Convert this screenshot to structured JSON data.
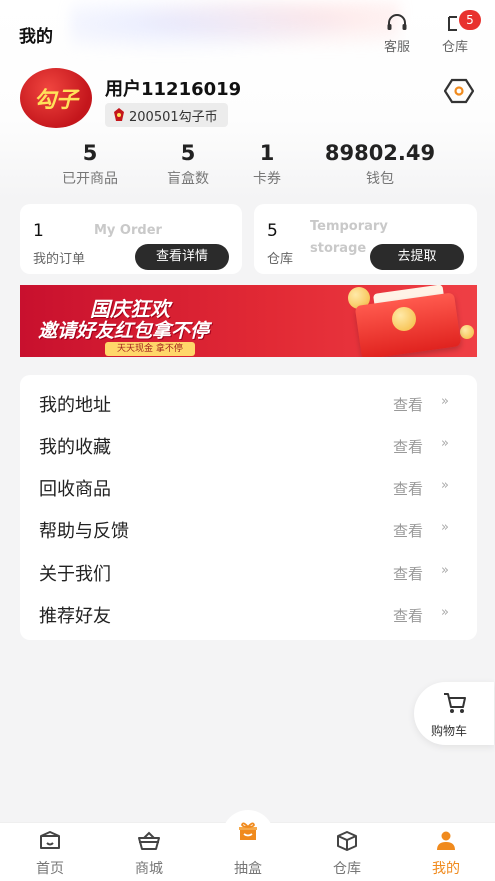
{
  "header": {
    "title": "我的",
    "service_label": "客服",
    "warehouse_label": "仓库",
    "warehouse_badge": "5"
  },
  "profile": {
    "avatar_text": "勾子",
    "username": "用户11216019",
    "coin_text": "200501勾子币"
  },
  "stats": [
    {
      "value": "5",
      "label": "已开商品"
    },
    {
      "value": "5",
      "label": "盲盒数"
    },
    {
      "value": "1",
      "label": "卡券"
    },
    {
      "value": "89802.49",
      "label": "钱包"
    }
  ],
  "order_card": {
    "count": "1",
    "english": "My Order",
    "name": "我的订单",
    "button": "查看详情"
  },
  "storage_card": {
    "count": "5",
    "english_1": "Temporary",
    "english_2": "storage",
    "name": "仓库",
    "button": "去提取"
  },
  "banner": {
    "line1": "国庆狂欢",
    "line2": "邀请好友红包拿不停",
    "sub": "天天现金 拿不停"
  },
  "menu": {
    "view_label": "查看",
    "items": [
      {
        "label": "我的地址"
      },
      {
        "label": "我的收藏"
      },
      {
        "label": "回收商品"
      },
      {
        "label": "帮助与反馈"
      },
      {
        "label": "关于我们"
      },
      {
        "label": "推荐好友"
      }
    ]
  },
  "cart": {
    "label": "购物车"
  },
  "tabs": [
    {
      "label": "首页",
      "icon": "home-box-icon"
    },
    {
      "label": "商城",
      "icon": "basket-icon"
    },
    {
      "label": "抽盒",
      "icon": "gift-box-icon"
    },
    {
      "label": "仓库",
      "icon": "cube-icon"
    },
    {
      "label": "我的",
      "icon": "person-icon"
    }
  ],
  "colors": {
    "accent": "#f08a1d",
    "badge": "#e8322e",
    "button_dark": "#2b2b2b",
    "banner_red": "#d91f2f"
  }
}
